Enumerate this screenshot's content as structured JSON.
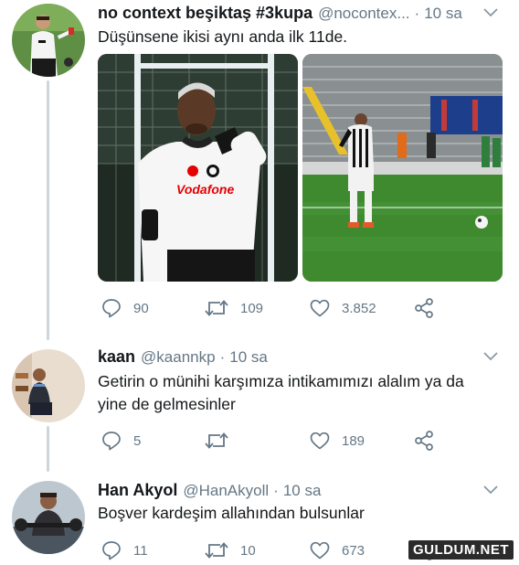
{
  "tweets": [
    {
      "display_name": "no context beşiktaş #3kupa",
      "handle": "@nocontex...",
      "separator": "·",
      "time": "10 sa",
      "text": "Düşünsene ikisi aynı anda ilk 11de.",
      "replies": "90",
      "retweets": "109",
      "likes": "3.852"
    },
    {
      "display_name": "kaan",
      "handle": "@kaannkp",
      "separator": "·",
      "time": "10 sa",
      "text": "Getirin o münihi karşımıza intikamımızı alalım ya da yine de gelmesinler",
      "replies": "5",
      "retweets": "",
      "likes": "189"
    },
    {
      "display_name": "Han Akyol",
      "handle": "@HanAkyoll",
      "separator": "·",
      "time": "10 sa",
      "text": "Boşver kardeşim allahından bulsunlar",
      "replies": "11",
      "retweets": "10",
      "likes": "673"
    }
  ],
  "photo_1": {
    "sponsor_text": "Vodafone"
  },
  "watermark": "GULDUM.NET",
  "colors": {
    "meta": "#657786",
    "text": "#14171a",
    "thread_line": "#ccd6dd",
    "pitch": "#3f8a2e"
  }
}
